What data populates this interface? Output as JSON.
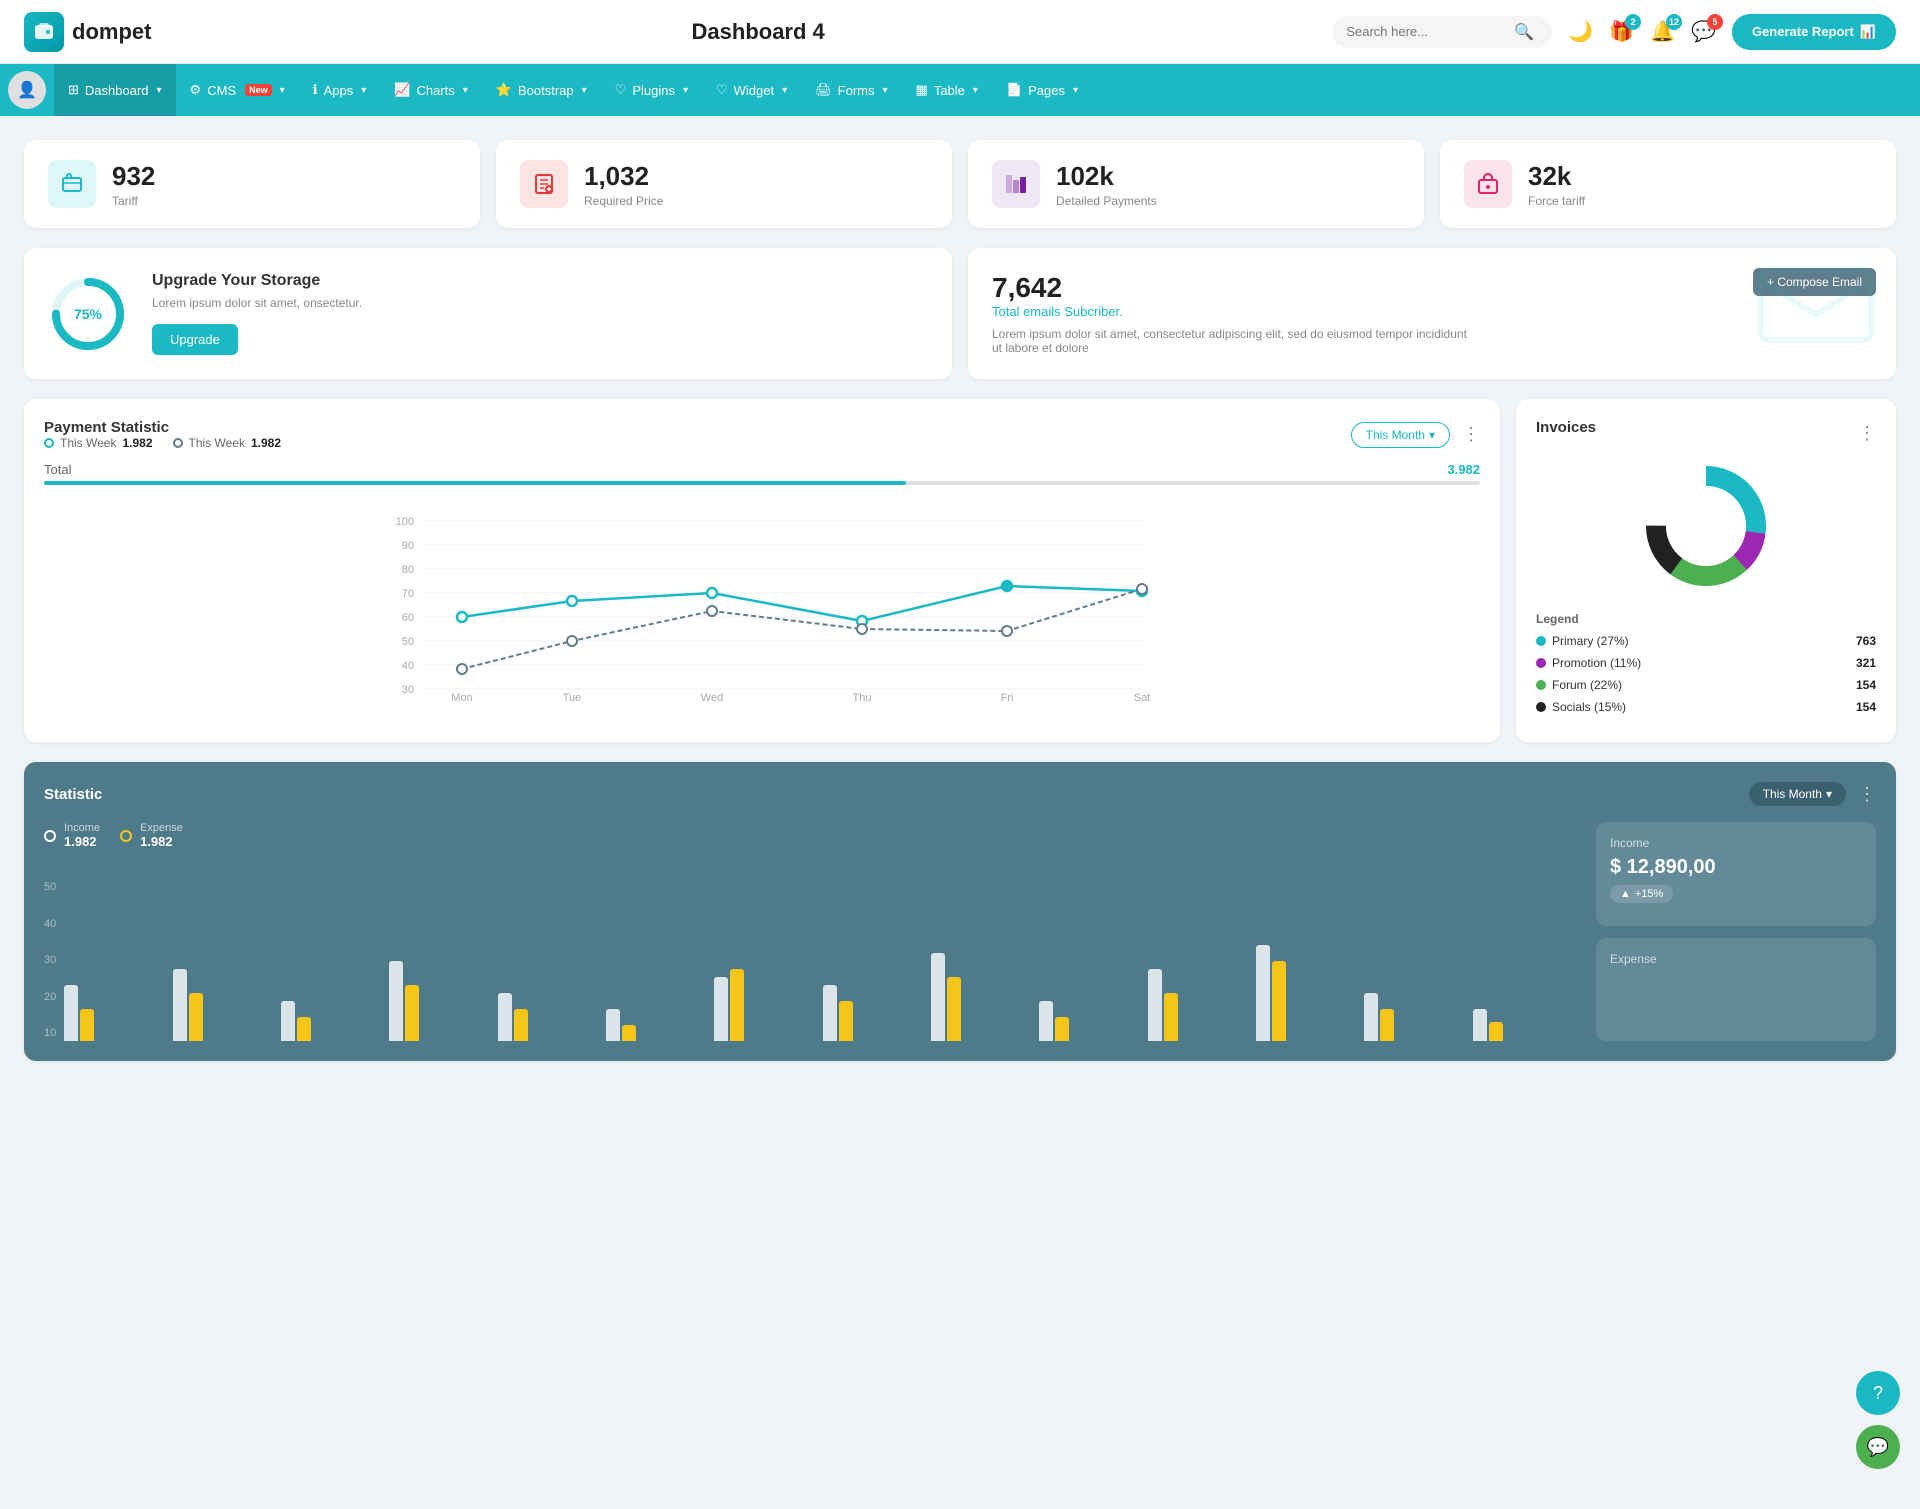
{
  "app": {
    "logo_text": "dompet",
    "page_title": "Dashboard 4",
    "search_placeholder": "Search here...",
    "generate_report_label": "Generate Report"
  },
  "nav_icons": {
    "dark_mode_icon": "🌙",
    "gift_icon": "🎁",
    "bell_icon": "🔔",
    "chat_icon": "💬",
    "gift_badge": "2",
    "bell_badge": "12",
    "chat_badge": "5"
  },
  "menu": {
    "items": [
      {
        "label": "Dashboard",
        "icon": "⊞",
        "has_caret": true,
        "active": true
      },
      {
        "label": "CMS",
        "icon": "⚙",
        "has_caret": true,
        "is_new": true
      },
      {
        "label": "Apps",
        "icon": "ℹ",
        "has_caret": true
      },
      {
        "label": "Charts",
        "icon": "📈",
        "has_caret": true
      },
      {
        "label": "Bootstrap",
        "icon": "⭐",
        "has_caret": true
      },
      {
        "label": "Plugins",
        "icon": "♡",
        "has_caret": true
      },
      {
        "label": "Widget",
        "icon": "♡",
        "has_caret": true
      },
      {
        "label": "Forms",
        "icon": "🖨",
        "has_caret": true
      },
      {
        "label": "Table",
        "icon": "▦",
        "has_caret": true
      },
      {
        "label": "Pages",
        "icon": "📄",
        "has_caret": true
      }
    ]
  },
  "stat_cards": [
    {
      "value": "932",
      "label": "Tariff",
      "icon_type": "teal",
      "icon": "💼"
    },
    {
      "value": "1,032",
      "label": "Required Price",
      "icon_type": "red",
      "icon": "📄"
    },
    {
      "value": "102k",
      "label": "Detailed Payments",
      "icon_type": "purple",
      "icon": "📊"
    },
    {
      "value": "32k",
      "label": "Force tariff",
      "icon_type": "pink",
      "icon": "🏢"
    }
  ],
  "upgrade_card": {
    "percent": 75,
    "percent_label": "75%",
    "title": "Upgrade Your Storage",
    "description": "Lorem ipsum dolor sit amet, onsectetur.",
    "button_label": "Upgrade"
  },
  "email_card": {
    "count": "7,642",
    "subtitle": "Total emails Subcriber.",
    "description": "Lorem ipsum dolor sit amet, consectetur adipiscing elit, sed do eiusmod tempor incididunt ut labore et dolore",
    "compose_label": "+ Compose Email"
  },
  "payment_chart": {
    "title": "Payment Statistic",
    "legend": [
      {
        "label": "This Week",
        "value": "1.982",
        "type": "teal"
      },
      {
        "label": "This Week",
        "value": "1.982",
        "type": "dark"
      }
    ],
    "this_month_label": "This Month",
    "total_label": "Total",
    "total_value": "3.982",
    "x_labels": [
      "Mon",
      "Tue",
      "Wed",
      "Thu",
      "Fri",
      "Sat"
    ],
    "y_labels": [
      "100",
      "90",
      "80",
      "70",
      "60",
      "50",
      "40",
      "30"
    ],
    "line1_points": "60,160 70,140 200,130 350,110 490,130 630,100 770,105",
    "line2_points": "60,170 70,160 200,155 350,165 490,155 630,140 770,110"
  },
  "invoices": {
    "title": "Invoices",
    "legend_header": "Legend",
    "items": [
      {
        "label": "Primary (27%)",
        "color": "#1ab9c4",
        "count": "763",
        "pct": 27
      },
      {
        "label": "Promotion (11%)",
        "color": "#9c27b0",
        "count": "321",
        "pct": 11
      },
      {
        "label": "Forum (22%)",
        "color": "#4caf50",
        "count": "154",
        "pct": 22
      },
      {
        "label": "Socials (15%)",
        "color": "#212121",
        "count": "154",
        "pct": 15
      }
    ]
  },
  "statistic": {
    "title": "Statistic",
    "this_month_label": "This Month",
    "y_labels": [
      "50",
      "40",
      "30",
      "20",
      "10"
    ],
    "income_label": "Income",
    "income_value": "1.982",
    "expense_label": "Expense",
    "expense_value": "1.982",
    "income_amount": "$ 12,890,00",
    "income_badge": "+15%",
    "expense_section_label": "Expense",
    "bars": [
      {
        "white": 35,
        "yellow": 20
      },
      {
        "white": 45,
        "yellow": 30
      },
      {
        "white": 25,
        "yellow": 15
      },
      {
        "white": 50,
        "yellow": 35
      },
      {
        "white": 30,
        "yellow": 20
      },
      {
        "white": 20,
        "yellow": 10
      },
      {
        "white": 40,
        "yellow": 45
      },
      {
        "white": 35,
        "yellow": 25
      },
      {
        "white": 55,
        "yellow": 40
      },
      {
        "white": 25,
        "yellow": 15
      },
      {
        "white": 45,
        "yellow": 30
      },
      {
        "white": 60,
        "yellow": 50
      },
      {
        "white": 30,
        "yellow": 20
      },
      {
        "white": 20,
        "yellow": 12
      }
    ]
  },
  "colors": {
    "teal": "#1ab9c4",
    "brand": "#1ab9c4",
    "menu_bg": "#1ab9c4"
  }
}
